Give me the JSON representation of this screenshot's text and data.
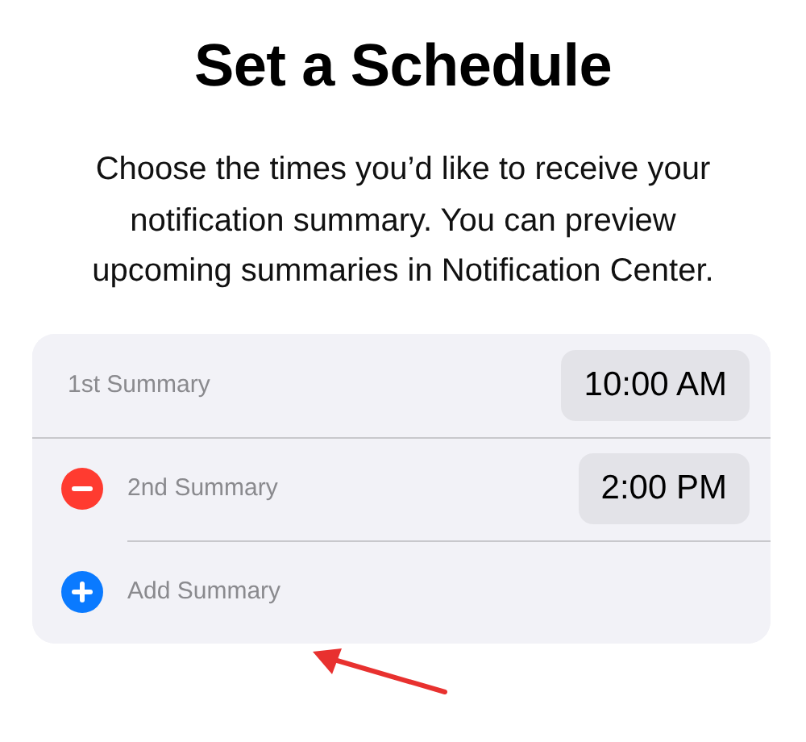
{
  "title": "Set a Schedule",
  "description": "Choose the times you’d like to receive your notification summary. You can preview upcoming summaries in Notification Center.",
  "rows": [
    {
      "kind": "summary",
      "label": "1st Summary",
      "removable": false,
      "time": "10:00 AM"
    },
    {
      "kind": "summary",
      "label": "2nd Summary",
      "removable": true,
      "time": "2:00 PM"
    },
    {
      "kind": "add",
      "label": "Add Summary"
    }
  ]
}
